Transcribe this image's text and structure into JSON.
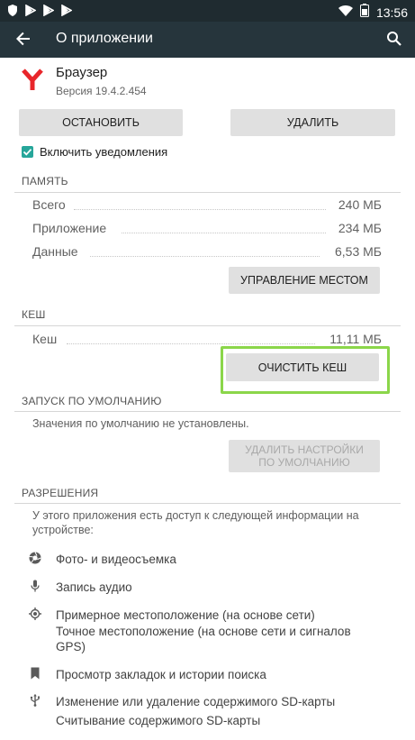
{
  "statusbar": {
    "time": "13:56",
    "left_icons": [
      "shield-icon",
      "play-icon",
      "play-icon",
      "play-icon"
    ],
    "right_icons": [
      "wifi-icon",
      "battery-icon"
    ]
  },
  "appbar": {
    "title": "О приложении",
    "back_icon": "arrow-back-icon",
    "search_icon": "search-icon"
  },
  "app": {
    "name": "Браузер",
    "version": "Версия 19.4.2.454",
    "icon": "yandex-browser-icon"
  },
  "actions": {
    "stop_label": "ОСТАНОВИТЬ",
    "delete_label": "УДАЛИТЬ"
  },
  "notifications": {
    "label": "Включить уведомления",
    "checked": true
  },
  "memory": {
    "section_title": "ПАМЯТЬ",
    "rows": [
      {
        "label": "Всего",
        "value": "240 МБ"
      },
      {
        "label": "Приложение",
        "value": "234 МБ"
      },
      {
        "label": "Данные",
        "value": "6,53 МБ"
      }
    ],
    "manage_label": "УПРАВЛЕНИЕ МЕСТОМ"
  },
  "cache": {
    "section_title": "КЕШ",
    "label": "Кеш",
    "value": "11,11 МБ",
    "clear_label": "ОЧИСТИТЬ КЕШ"
  },
  "defaults": {
    "section_title": "ЗАПУСК ПО УМОЛЧАНИЮ",
    "text": "Значения по умолчанию не установлены.",
    "reset_line1": "УДАЛИТЬ НАСТРОЙКИ",
    "reset_line2": "ПО УМОЛЧАНИЮ"
  },
  "permissions": {
    "section_title": "РАЗРЕШЕНИЯ",
    "intro_line1": "У этого приложения есть доступ к следующей информации на",
    "intro_line2": "устройстве:",
    "items": [
      {
        "icon": "camera-icon",
        "lines": [
          "Фото- и видеосъемка"
        ]
      },
      {
        "icon": "microphone-icon",
        "lines": [
          "Запись аудио"
        ]
      },
      {
        "icon": "location-icon",
        "lines": [
          "Примерное местоположение (на основе сети)",
          "Точное местоположение (на основе сети и сигналов",
          "GPS)"
        ]
      },
      {
        "icon": "bookmark-icon",
        "lines": [
          "Просмотр закладок и истории поиска"
        ]
      },
      {
        "icon": "usb-icon",
        "lines": [
          "Изменение или удаление содержимого SD-карты",
          "Считывание содержимого SD-карты"
        ]
      }
    ]
  }
}
